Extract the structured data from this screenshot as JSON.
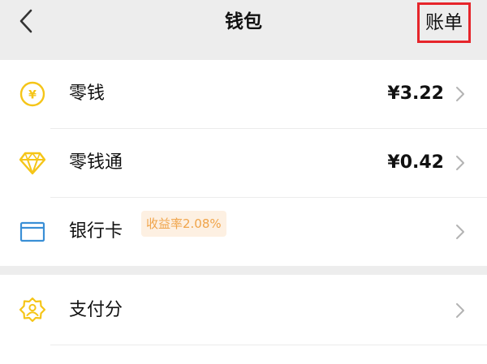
{
  "header": {
    "title": "钱包",
    "bill_label": "账单",
    "back_icon": "chevron-left-icon"
  },
  "items": [
    {
      "label": "零钱",
      "value": "¥3.22",
      "icon": "yuan-coin-icon",
      "icon_color": "#f5c518"
    },
    {
      "label": "零钱通",
      "value": "¥0.42",
      "badge": "收益率2.08%",
      "icon": "diamond-icon",
      "icon_color": "#f5c518"
    },
    {
      "label": "银行卡",
      "icon": "bank-card-icon",
      "icon_color": "#3a8fd6"
    },
    {
      "label": "支付分",
      "icon": "payscore-badge-icon",
      "icon_color": "#f5c518"
    }
  ],
  "colors": {
    "background": "#ededed",
    "card": "#ffffff",
    "highlight_border": "#e6252b",
    "badge_bg": "#fdf0e2",
    "badge_text": "#f0a44a"
  }
}
